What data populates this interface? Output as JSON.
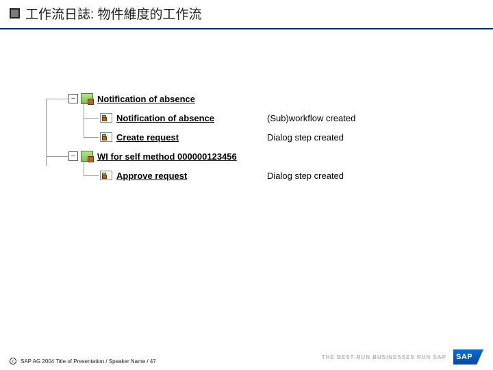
{
  "title": "工作流日誌: 物件維度的工作流",
  "tree": {
    "n0": {
      "label": "Notification of absence"
    },
    "n1": {
      "label": "Notification of absence",
      "status": "(Sub)workflow created"
    },
    "n2": {
      "label": "Create request",
      "status": "Dialog step created"
    },
    "n3": {
      "label": "WI for self method 000000123456"
    },
    "n4": {
      "label": "Approve request",
      "status": "Dialog step created"
    }
  },
  "footer": {
    "copyright": "SAP AG 2004  Title of Presentation / Speaker Name / 47",
    "tagline": "THE BEST-RUN BUSINESSES RUN SAP",
    "logo": "SAP"
  }
}
